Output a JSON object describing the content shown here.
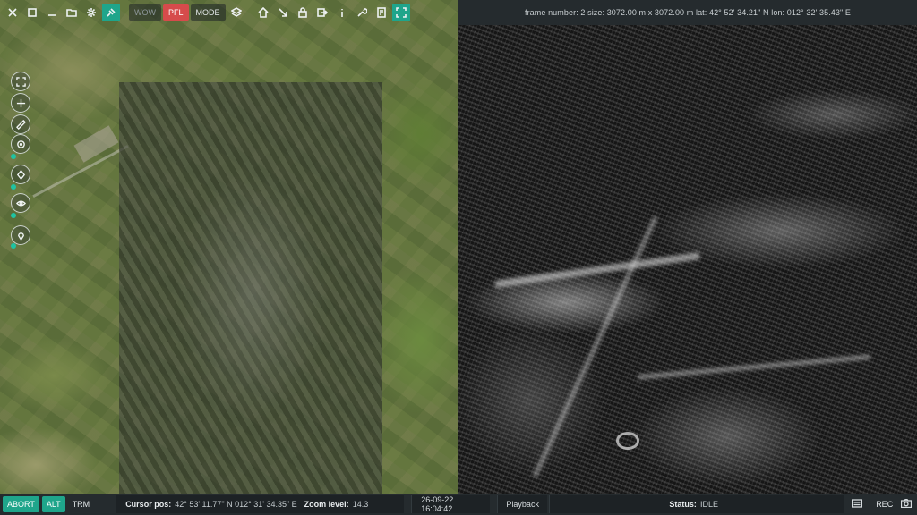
{
  "toolbar": {
    "buttons": [
      {
        "name": "close-icon"
      },
      {
        "name": "window-icon"
      },
      {
        "name": "minimize-icon"
      },
      {
        "name": "folder-icon"
      },
      {
        "name": "gear-icon"
      },
      {
        "name": "satellite-icon",
        "active": true
      }
    ],
    "wow_label": "WOW",
    "pfl_label": "PFL",
    "mode_label": "MODE",
    "icons": [
      "layers-icon",
      "home-icon",
      "north-arrow-icon",
      "lock-icon",
      "export-icon",
      "info-icon",
      "tools-icon",
      "report-icon",
      "fullscreen-icon"
    ]
  },
  "frame_info": {
    "text": "frame number: 2  size: 3072.00 m  x 3072.00 m   lat: 42° 52' 34.21\" N  lon: 012° 32' 35.43\" E"
  },
  "side_tools": [
    "zoom-extent-icon",
    "pan-icon",
    "measure-icon",
    "target-icon",
    "marker-icon",
    "eye-icon",
    "location-pin-icon"
  ],
  "bottom": {
    "abort_label": "ABORT",
    "alt_label": "ALT",
    "trm_label": "TRM",
    "cursor_label": "Cursor pos:",
    "cursor_value": "42° 53' 11.77\" N 012° 31' 34.35\" E",
    "zoom_label": "Zoom level:",
    "zoom_value": "14.3",
    "datetime": "26-09-22 16:04:42",
    "playback_label": "Playback",
    "status_label": "Status:",
    "status_value": "IDLE",
    "rec_label": "REC"
  },
  "colors": {
    "accent": "#1fa58b",
    "pfl": "#d64b4b",
    "bar_bg": "#252b2e"
  }
}
